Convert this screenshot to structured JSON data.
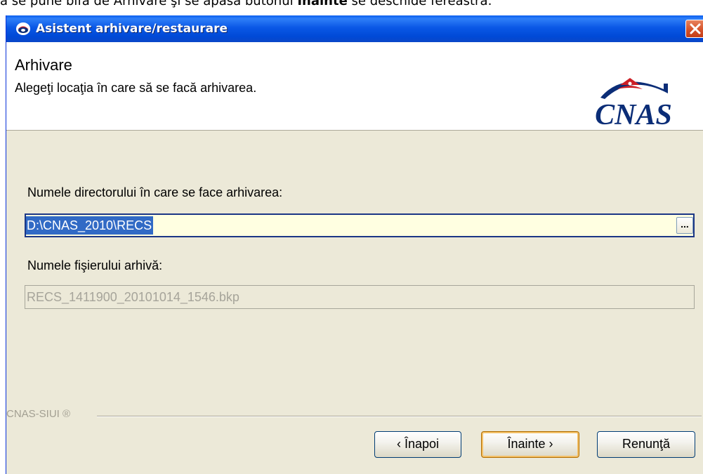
{
  "caption": {
    "before": "a se pune bifa de Arhivare şi se apasă butonul ",
    "bold": "Înainte",
    "after": " se deschide fereastra:"
  },
  "window": {
    "title": "Asistent arhivare/restaurare",
    "icon": "cnas-app-icon",
    "close_icon": "close-icon"
  },
  "header": {
    "title": "Arhivare",
    "subtitle": "Alegeţi locaţia în care să se facă arhivarea.",
    "logo_text": "CNAS"
  },
  "form": {
    "dir_label": "Numele directorului în care se face arhivarea:",
    "dir_value": "D:\\CNAS_2010\\RECS",
    "browse_label": "...",
    "file_label": "Numele fişierului arhivă:",
    "file_value": "RECS_1411900_20101014_1546.bkp"
  },
  "footer": {
    "brand": "CNAS-SIUI ®"
  },
  "buttons": {
    "back": "‹ Înapoi",
    "next": "Înainte ›",
    "cancel": "Renunţă"
  },
  "colors": {
    "titlebar": "#0a58e6",
    "selection": "#316ac5",
    "input_bg": "#ffffe1",
    "logo_navy": "#0b2d77",
    "logo_red": "#cc1f26"
  }
}
